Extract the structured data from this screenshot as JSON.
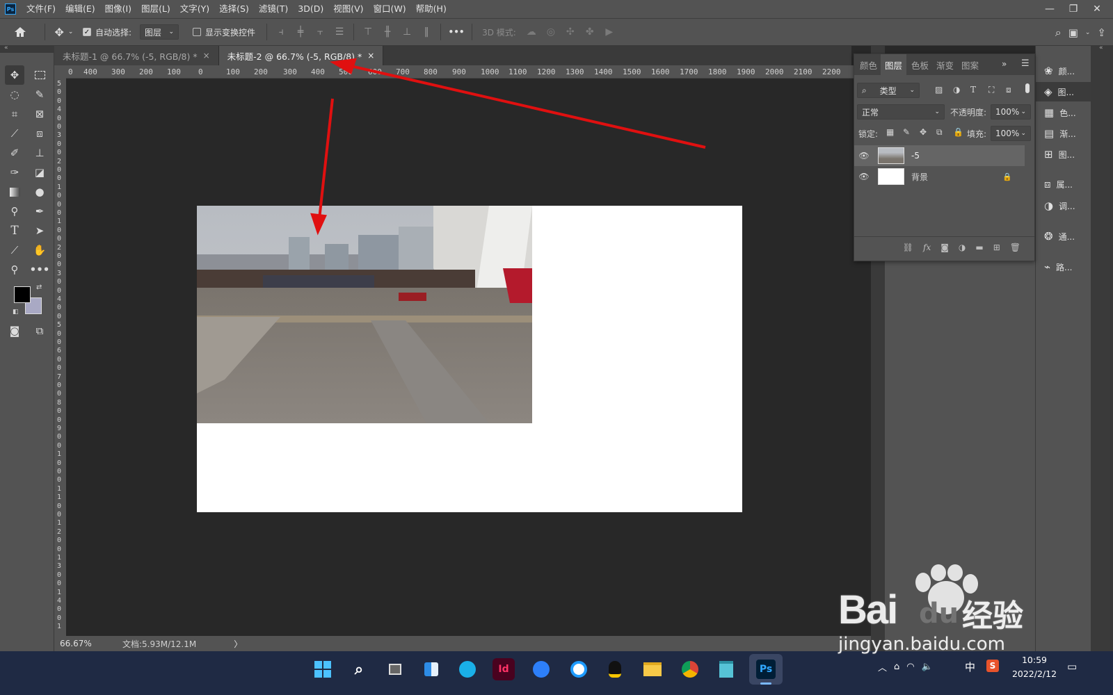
{
  "app": {
    "logo": "Ps"
  },
  "menu": [
    "文件(F)",
    "编辑(E)",
    "图像(I)",
    "图层(L)",
    "文字(Y)",
    "选择(S)",
    "滤镜(T)",
    "3D(D)",
    "视图(V)",
    "窗口(W)",
    "帮助(H)"
  ],
  "window_controls": {
    "minimize": "—",
    "restore": "❐",
    "close": "✕"
  },
  "options": {
    "auto_select_label": "自动选择:",
    "auto_select_value": "图层",
    "show_transform_label": "显示变换控件",
    "more": "•••",
    "mode_3d_label": "3D 模式:"
  },
  "tabs": [
    {
      "title": "未标题-1 @ 66.7% (-5, RGB/8) *",
      "close": "×"
    },
    {
      "title": "未标题-2 @ 66.7% (-5, RGB/8) *",
      "close": "×"
    }
  ],
  "ruler_h": [
    "0",
    "400",
    "300",
    "200",
    "100",
    "0",
    "100",
    "200",
    "300",
    "400",
    "500",
    "600",
    "700",
    "800",
    "900",
    "1000",
    "1100",
    "1200",
    "1300",
    "1400",
    "1500",
    "1600",
    "1700",
    "1800",
    "1900",
    "2000",
    "2100",
    "2200"
  ],
  "ruler_v": [
    "5",
    "0",
    "0",
    "4",
    "0",
    "0",
    "3",
    "0",
    "0",
    "2",
    "0",
    "0",
    "1",
    "0",
    "0",
    "0",
    "1",
    "0",
    "0",
    "2",
    "0",
    "0",
    "3",
    "0",
    "0",
    "4",
    "0",
    "0",
    "5",
    "0",
    "0",
    "6",
    "0",
    "0",
    "7",
    "0",
    "0",
    "8",
    "0",
    "0",
    "9",
    "0",
    "0",
    "1",
    "0",
    "0",
    "0",
    "1",
    "1",
    "0",
    "0",
    "1",
    "2",
    "0",
    "0",
    "1",
    "3",
    "0",
    "0",
    "1",
    "4",
    "0",
    "0",
    "1"
  ],
  "status": {
    "zoom": "66.67%",
    "doc": "文档:5.93M/12.1M",
    "arrow": "〉"
  },
  "layers_panel": {
    "tabs": [
      "颜色",
      "图层",
      "色板",
      "渐变",
      "图案"
    ],
    "filter_type": "类型",
    "blend_mode": "正常",
    "opacity_label": "不透明度:",
    "opacity_value": "100%",
    "lock_label": "锁定:",
    "fill_label": "填充:",
    "fill_value": "100%",
    "layers": [
      {
        "name": "-5",
        "selected": true
      },
      {
        "name": "背景",
        "locked": true
      }
    ]
  },
  "dock": [
    {
      "label": "颜...",
      "icon": "palette-icon"
    },
    {
      "label": "图...",
      "icon": "layers-icon"
    },
    {
      "label": "色...",
      "icon": "swatches-icon"
    },
    {
      "label": "渐...",
      "icon": "gradient-icon"
    },
    {
      "label": "图...",
      "icon": "pattern-icon"
    },
    {
      "label": "属...",
      "icon": "properties-icon"
    },
    {
      "label": "调...",
      "icon": "adjustments-icon"
    },
    {
      "label": "通...",
      "icon": "channels-icon"
    },
    {
      "label": "路...",
      "icon": "paths-icon"
    }
  ],
  "taskbar": {
    "apps": [
      "start-icon",
      "search-icon",
      "task-view-icon",
      "widgets-icon",
      "edge-icon",
      "indesign-icon",
      "feishu-icon",
      "browser-icon",
      "qq-icon",
      "explorer-icon",
      "chrome-icon",
      "notepad-icon",
      "photoshop-icon"
    ],
    "id_label": "Id",
    "ps_label": "Ps",
    "ime": "中",
    "ime2": "S",
    "time": "10:59",
    "date": "2022/2/12"
  },
  "watermark": {
    "brand": "Bai",
    "brand2": "du",
    "cn": "经验",
    "url": "jingyan.baidu.com"
  },
  "colors": {
    "accent_arrow": "#e01010",
    "ps_blue": "#31a8ff",
    "ui_gray": "#535353",
    "canvas_bg": "#282828"
  }
}
